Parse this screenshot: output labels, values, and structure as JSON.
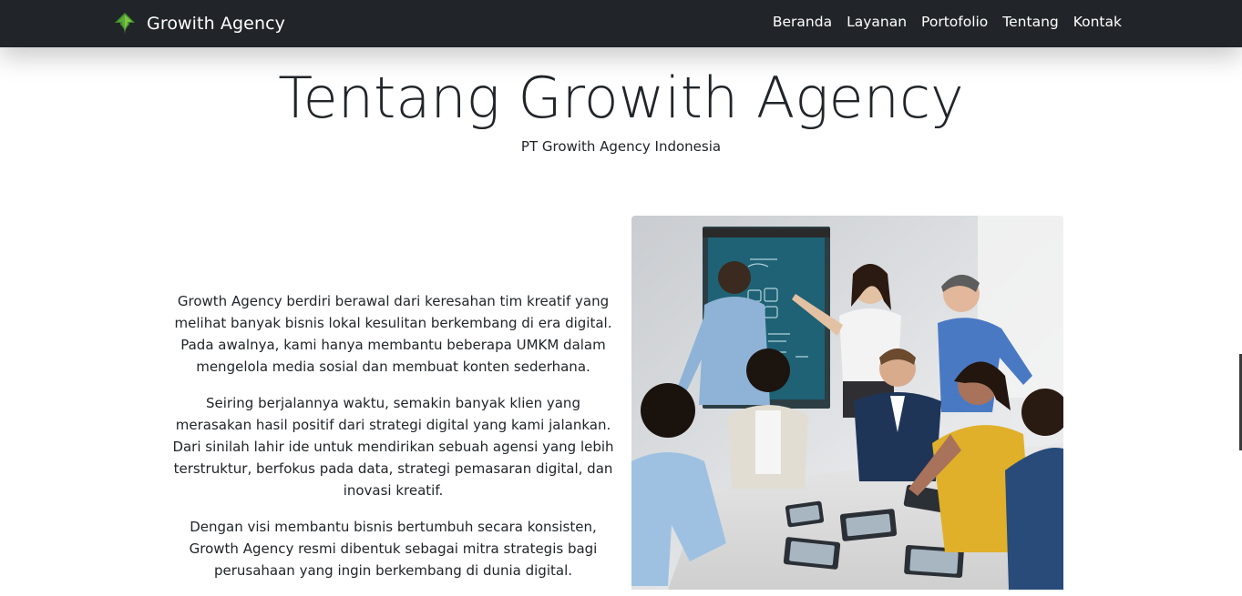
{
  "navbar": {
    "brand_name": "Growith Agency",
    "logo_icon": "leaf-arrow-logo-icon",
    "links": [
      "Beranda",
      "Layanan",
      "Portofolio",
      "Tentang",
      "Kontak"
    ]
  },
  "hero": {
    "title": "Tentang Growith Agency",
    "subtitle": "PT Growith Agency Indonesia"
  },
  "about": {
    "paragraphs": [
      "Growth Agency berdiri berawal dari keresahan tim kreatif yang melihat banyak bisnis lokal kesulitan berkembang di era digital. Pada awalnya, kami hanya membantu beberapa UMKM dalam mengelola media sosial dan membuat konten sederhana.",
      "Seiring berjalannya waktu, semakin banyak klien yang merasakan hasil positif dari strategi digital yang kami jalankan. Dari sinilah lahir ide untuk mendirikan sebuah agensi yang lebih terstruktur, berfokus pada data, strategi pemasaran digital, dan inovasi kreatif.",
      "Dengan visi membantu bisnis bertumbuh secara konsisten, Growth Agency resmi dibentuk sebagai mitra strategis bagi perusahaan yang ingin berkembang di dunia digital."
    ]
  },
  "colors": {
    "navbar_bg": "#212529",
    "logo_green": "#4caf50",
    "text": "#212529"
  }
}
